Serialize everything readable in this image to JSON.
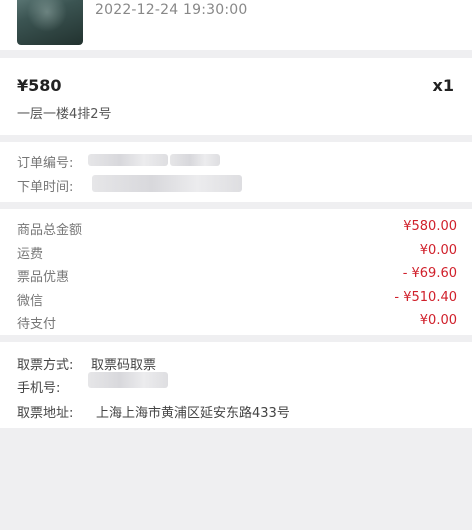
{
  "event": {
    "time": "2022-12-24 19:30:00"
  },
  "ticket": {
    "price": "¥580",
    "quantity": "x1",
    "seat": "一层一楼4排2号"
  },
  "order": {
    "order_no_label": "订单编号:",
    "order_time_label": "下单时间:"
  },
  "amounts": [
    {
      "label": "商品总金额",
      "value": "¥580.00"
    },
    {
      "label": "运费",
      "value": "¥0.00"
    },
    {
      "label": "票品优惠",
      "value": "- ¥69.60"
    },
    {
      "label": "微信",
      "value": "- ¥510.40"
    },
    {
      "label": "待支付",
      "value": "¥0.00"
    }
  ],
  "delivery": {
    "method_label": "取票方式:",
    "method_value": "取票码取票",
    "phone_label": "手机号:",
    "address_label": "取票地址:",
    "address_value": "上海上海市黄浦区延安东路433号"
  },
  "colors": {
    "accent_red": "#d0202b",
    "page_background": "#efeff1"
  }
}
